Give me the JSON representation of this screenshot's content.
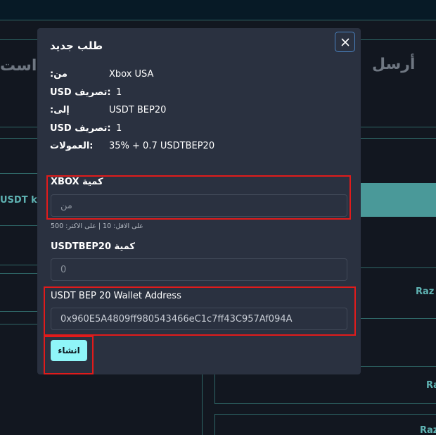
{
  "background": {
    "heading_right": "أرسل",
    "heading_left": "است",
    "row_left_label": "USDT k",
    "row_right_labels": [
      "Raz",
      "Ra",
      "Raz"
    ]
  },
  "modal": {
    "title": "طلب جديد",
    "close_symbol": "×",
    "info": [
      {
        "label": ":من",
        "value": "Xbox USA"
      },
      {
        "label": "USD تصريف:",
        "value": "1"
      },
      {
        "label": ":إلى",
        "value": "USDT BEP20"
      },
      {
        "label": "USD تصريف:",
        "value": "1"
      },
      {
        "label": "العمولات:",
        "value": "35% + 0.7 USDTBEP20"
      }
    ],
    "from_field": {
      "label": "XBOX كمية",
      "placeholder": "من",
      "value": "",
      "hint": "على الاقل: 10 | على الاكثر: 500"
    },
    "to_field": {
      "label": "USDTBEP20 كمية",
      "placeholder": "0",
      "value": ""
    },
    "wallet_field": {
      "label": "USDT BEP 20 Wallet Address",
      "value": "0x960E5A4809ff980543466eC1c7ff43C957Af094A"
    },
    "submit_label": "انشاء"
  },
  "colors": {
    "page_bg": "#121720",
    "modal_bg": "#2a3140",
    "accent": "#8ff5f8",
    "highlight": "#e11b1b",
    "teal_line": "#2e6666"
  }
}
